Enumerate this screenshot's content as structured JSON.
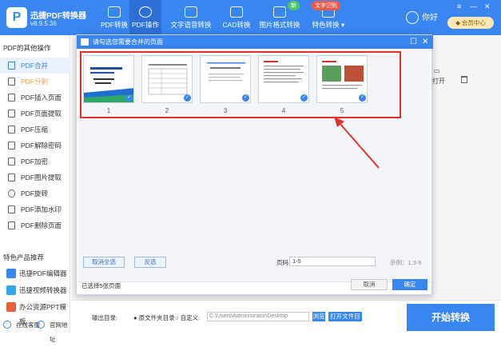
{
  "app": {
    "name": "迅捷PDF转换器",
    "version": "v8.9.5.36",
    "logo_glyph": "P"
  },
  "nav": [
    {
      "label": "PDF转换",
      "icon": "convert-icon"
    },
    {
      "label": "PDF操作",
      "icon": "pdf-operation-icon",
      "active": true
    },
    {
      "label": "文字语音转换",
      "icon": "voice-icon"
    },
    {
      "label": "CAD转换",
      "icon": "cad-icon"
    },
    {
      "label": "图片格式转换",
      "icon": "image-icon",
      "badge": "新"
    },
    {
      "label": "特色转换",
      "icon": "feature-icon",
      "badge": "文字识别"
    }
  ],
  "user": {
    "name": "你好",
    "vip": "会员中心"
  },
  "window": {
    "menu": "≡",
    "minimize": "—",
    "close": "✕"
  },
  "sidebar": {
    "heading": "PDF的其他操作",
    "items": [
      {
        "label": "PDF合并",
        "selected": true
      },
      {
        "label": "PDF分割",
        "dimmed": true
      },
      {
        "label": "PDF插入页面"
      },
      {
        "label": "PDF页面提取"
      },
      {
        "label": "PDF压缩"
      },
      {
        "label": "PDF解除密码"
      },
      {
        "label": "PDF加密"
      },
      {
        "label": "PDF图片提取"
      },
      {
        "label": "PDF旋转"
      },
      {
        "label": "PDF添加水印"
      },
      {
        "label": "PDF删除页面"
      }
    ],
    "products_heading": "特色产品推荐",
    "products": [
      {
        "label": "迅捷PDF编辑器"
      },
      {
        "label": "迅捷视频转换器"
      },
      {
        "label": "办公资源PPT模板"
      }
    ],
    "footer": {
      "service": "在线客服",
      "website": "官网地址"
    }
  },
  "toolbar_right": {
    "open": "打开",
    "delete_icon": "trash-icon"
  },
  "bottom": {
    "output_label": "输出目录:",
    "radio_original": "原文件夹目录",
    "radio_custom": "自定义:",
    "path": "C:\\Users\\Administrator\\Desktop",
    "browse": "浏览",
    "open_folder": "打开文件目录",
    "start": "开始转换"
  },
  "dialog": {
    "title": "请勾选您需要合并的页面",
    "pages": [
      "1",
      "2",
      "3",
      "4",
      "5"
    ],
    "cancel_all": "取消全选",
    "invert": "反选",
    "page_label": "页码",
    "page_value": "1-5",
    "example": "示例：1,3-5",
    "selected_status": "已选择5张页面",
    "cancel": "取消",
    "ok": "确定"
  },
  "colors": {
    "brand": "#3a86f0",
    "highlight": "#e0322c"
  }
}
